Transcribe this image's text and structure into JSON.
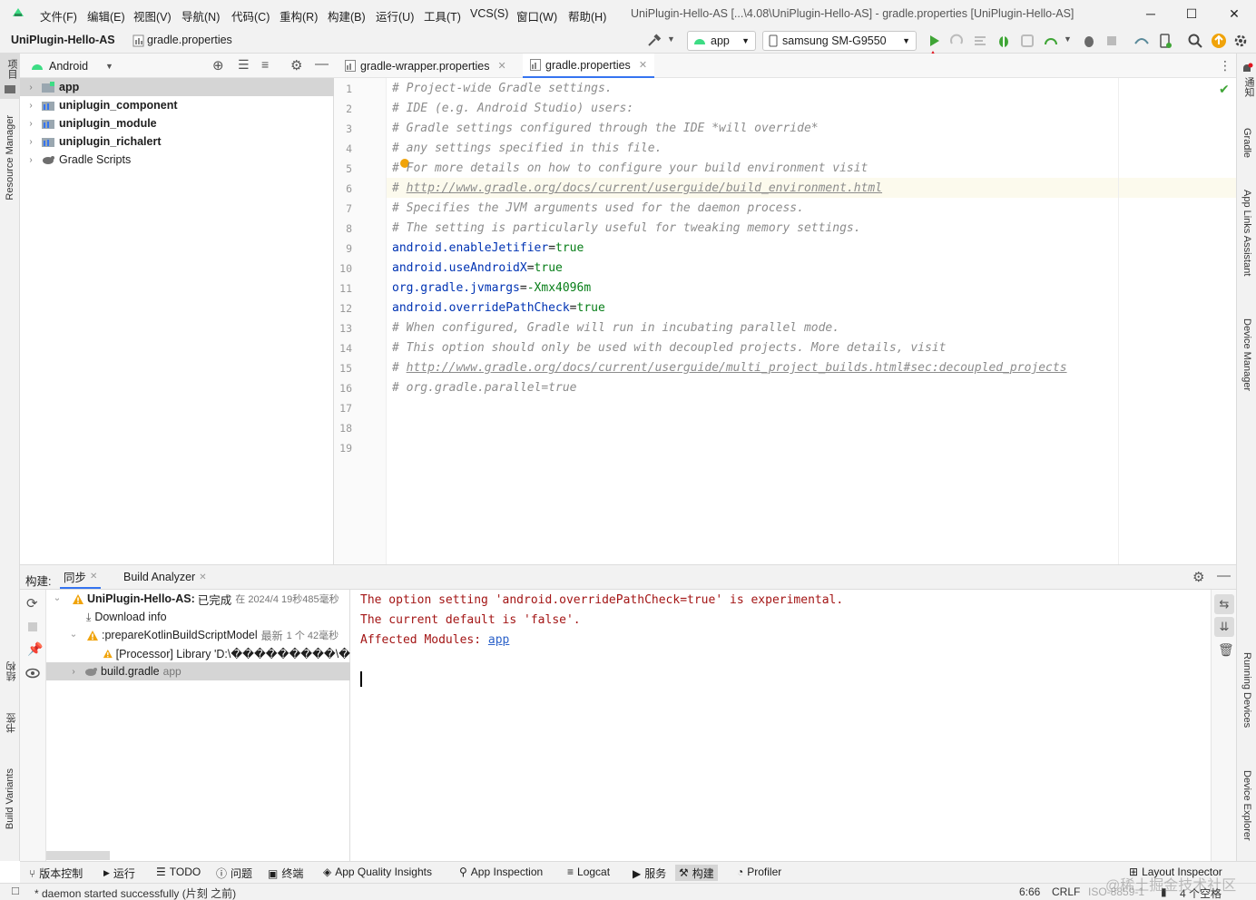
{
  "menu": {
    "items": [
      "文件(F)",
      "编辑(E)",
      "视图(V)",
      "导航(N)",
      "代码(C)",
      "重构(R)",
      "构建(B)",
      "运行(U)",
      "工具(T)",
      "VCS(S)",
      "窗口(W)",
      "帮助(H)"
    ],
    "window_title": "UniPlugin-Hello-AS [...\\4.08\\UniPlugin-Hello-AS] - gradle.properties [UniPlugin-Hello-AS]"
  },
  "navbar": {
    "project": "UniPlugin-Hello-AS",
    "file": "gradle.properties",
    "run_config": "app",
    "device": "samsung SM-G9550"
  },
  "left_stripe": {
    "project_label": "项目",
    "resource_manager": "Resource Manager",
    "structure": "结构",
    "bookmarks": "书签",
    "build_variants": "Build Variants"
  },
  "right_stripe": {
    "notifications": "通知",
    "gradle": "Gradle",
    "app_links": "App Links Assistant",
    "device_manager": "Device Manager",
    "running_devices": "Running Devices",
    "device_explorer": "Device Explorer"
  },
  "project_panel": {
    "view_mode": "Android",
    "items": [
      {
        "label": "app",
        "bold": true
      },
      {
        "label": "uniplugin_component",
        "bold": true
      },
      {
        "label": "uniplugin_module",
        "bold": true
      },
      {
        "label": "uniplugin_richalert",
        "bold": true
      },
      {
        "label": "Gradle Scripts",
        "bold": false
      }
    ]
  },
  "editor": {
    "tabs": [
      "gradle-wrapper.properties",
      "gradle.properties"
    ],
    "line_numbers": [
      "1",
      "2",
      "3",
      "4",
      "5",
      "6",
      "7",
      "8",
      "9",
      "10",
      "11",
      "12",
      "13",
      "14",
      "15",
      "16",
      "17",
      "18",
      "19"
    ],
    "lines": [
      {
        "type": "comment",
        "text": "# Project-wide Gradle settings."
      },
      {
        "type": "comment",
        "text": "# IDE (e.g. Android Studio) users:"
      },
      {
        "type": "comment",
        "text": "# Gradle settings configured through the IDE *will override*"
      },
      {
        "type": "comment",
        "text": "# any settings specified in this file."
      },
      {
        "type": "comment",
        "text": "# For more details on how to configure your build environment visit"
      },
      {
        "type": "url",
        "prefix": "# ",
        "text": "http://www.gradle.org/docs/current/userguide/build_environment.html"
      },
      {
        "type": "comment",
        "text": "# Specifies the JVM arguments used for the daemon process."
      },
      {
        "type": "comment",
        "text": "# The setting is particularly useful for tweaking memory settings."
      },
      {
        "type": "prop",
        "key": "android.enableJetifier",
        "value": "true"
      },
      {
        "type": "prop",
        "key": "android.useAndroidX",
        "value": "true"
      },
      {
        "type": "prop",
        "key": "org.gradle.jvmargs",
        "value": "-Xmx4096m"
      },
      {
        "type": "prop",
        "key": "android.overridePathCheck",
        "value": "true"
      },
      {
        "type": "comment",
        "text": "# When configured, Gradle will run in incubating parallel mode."
      },
      {
        "type": "comment",
        "text": "# This option should only be used with decoupled projects. More details, visit"
      },
      {
        "type": "url",
        "prefix": "# ",
        "text": "http://www.gradle.org/docs/current/userguide/multi_project_builds.html#sec:decoupled_projects"
      },
      {
        "type": "comment",
        "text": "# org.gradle.parallel=true"
      }
    ]
  },
  "build": {
    "title": "构建:",
    "tabs": [
      "同步",
      "Build Analyzer"
    ],
    "tree": [
      {
        "label": "UniPlugin-Hello-AS:",
        "status": "已完成",
        "meta": "在 2024/4 19秒485毫秒"
      },
      {
        "label": "Download info",
        "meta": ""
      },
      {
        "label": ":prepareKotlinBuildScriptModel",
        "status": "最新",
        "meta": "1 个 42毫秒"
      },
      {
        "label": "[Processor] Library 'D:\\���������\\�",
        "meta": ""
      },
      {
        "label": "build.gradle",
        "meta": "app"
      }
    ],
    "console": {
      "line1": "The option setting 'android.overridePathCheck=true' is experimental.",
      "line2": "The current default is 'false'.",
      "line3_prefix": "Affected Modules: ",
      "line3_link": "app"
    }
  },
  "bottom_tools": [
    "版本控制",
    "运行",
    "TODO",
    "问题",
    "终端",
    "App Quality Insights",
    "App Inspection",
    "Logcat",
    "服务",
    "构建",
    "Profiler",
    "Layout Inspector"
  ],
  "status": {
    "message": "* daemon started successfully (片刻 之前)",
    "position": "6:66",
    "line_sep": "CRLF",
    "encoding": "ISO-8859-1",
    "indent": "4 个空格",
    "watermark": "@稀土掘金技术社区"
  },
  "colors": {
    "accent": "#3574f0",
    "run_green": "#3fa536",
    "arrow_red": "#e0141e",
    "warning": "#f0a30a",
    "error_text": "#a31515"
  }
}
